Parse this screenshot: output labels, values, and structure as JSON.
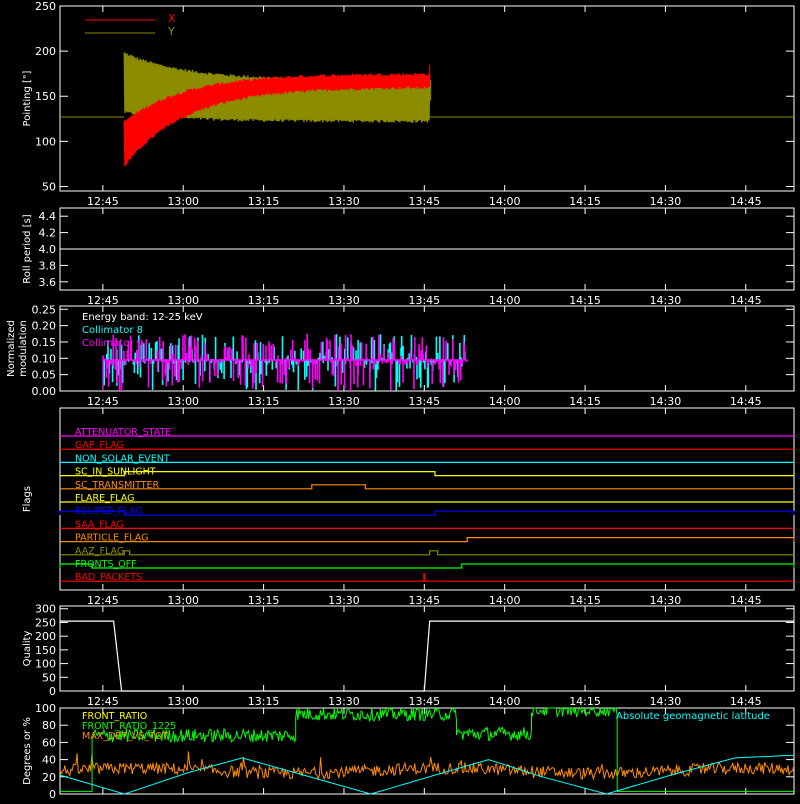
{
  "colors": {
    "background": "#000000",
    "frame": "#ffffff",
    "x_red": "#ff0000",
    "y_olive": "#8c8c00",
    "cyan": "#00ffff",
    "magenta": "#ff00ff",
    "green": "#00ff00",
    "orange": "#ff8c00",
    "yellow": "#ffff00",
    "blue": "#0000ff"
  },
  "x_axis": {
    "range_minutes": [
      -68,
      69
    ],
    "tick_minutes": [
      -60,
      -45,
      -30,
      -15,
      0,
      15,
      30,
      45,
      60
    ],
    "tick_labels": [
      "12:45",
      "13:00",
      "13:15",
      "13:30",
      "13:45",
      "14:00",
      "14:15",
      "14:30",
      "14:45"
    ]
  },
  "chart_data": [
    {
      "type": "line",
      "panel": "pointing",
      "ylabel": "Pointing [\"]",
      "ylim": [
        45,
        250
      ],
      "yticks": [
        50,
        100,
        150,
        200,
        250
      ],
      "legend_placement": "top-left",
      "series": [
        {
          "name": "X",
          "color": "#ff0000",
          "baseline": 127,
          "active_minutes": [
            -56,
            1
          ],
          "envelope_start": [
            72,
            122
          ],
          "envelope_end": [
            160,
            175
          ],
          "end_value": 185
        },
        {
          "name": "Y",
          "color": "#8c8c00",
          "baseline": 127,
          "active_minutes": [
            -56,
            1
          ],
          "envelope_start": [
            132,
            198
          ],
          "envelope_end": [
            122,
            168
          ],
          "end_value": 145
        }
      ]
    },
    {
      "type": "line",
      "panel": "roll",
      "ylabel": "Roll period [s]",
      "ylim": [
        3.5,
        4.5
      ],
      "yticks": [
        3.6,
        3.8,
        4.0,
        4.2,
        4.4
      ],
      "series": [
        {
          "color": "#ffffff",
          "value": 4.0
        }
      ]
    },
    {
      "type": "bar",
      "panel": "modulation",
      "ylabel": "Normalized modulation",
      "ylim": [
        0,
        0.26
      ],
      "yticks": [
        0.0,
        0.05,
        0.1,
        0.15,
        0.2,
        0.25
      ],
      "annotation": "Energy band: 12-25 keV",
      "baseline": 0.095,
      "active_minutes": [
        -60,
        8
      ],
      "series": [
        {
          "name": "Collimator 8",
          "color": "#00ffff"
        },
        {
          "name": "Collimator 9",
          "color": "#ff00ff"
        }
      ]
    },
    {
      "type": "line",
      "panel": "flags",
      "ylabel": "Flags",
      "flags": [
        {
          "name": "ATTENUATOR_STATE",
          "color": "#ff00ff",
          "high": []
        },
        {
          "name": "GAP_FLAG",
          "color": "#ff0000",
          "high": []
        },
        {
          "name": "NON_SOLAR_EVENT",
          "color": "#00ffff",
          "high": []
        },
        {
          "name": "SC_IN_SUNLIGHT",
          "color": "#ffff00",
          "high": [
            [
              -56,
              2
            ]
          ]
        },
        {
          "name": "SC_TRANSMITTER",
          "color": "#ff8c00",
          "high": [
            [
              -21,
              -11
            ]
          ]
        },
        {
          "name": "FLARE_FLAG",
          "color": "#ffff00",
          "high": []
        },
        {
          "name": "ECLIPSE_FLAG",
          "color": "#0000ff",
          "high": [
            [
              -68,
              -56
            ],
            [
              2,
              69
            ]
          ]
        },
        {
          "name": "SAA_FLAG",
          "color": "#ff0000",
          "high": []
        },
        {
          "name": "PARTICLE_FLAG",
          "color": "#ff8c00",
          "high": [
            [
              8,
              69
            ]
          ]
        },
        {
          "name": "AAZ_FLAG",
          "color": "#8c8c00",
          "high": [
            [
              -56,
              -55
            ],
            [
              1,
              2.5
            ]
          ]
        },
        {
          "name": "FRONTS_OFF",
          "color": "#00ff00",
          "high": [
            [
              -68,
              -62
            ],
            [
              7,
              69
            ]
          ]
        },
        {
          "name": "BAD_PACKETS",
          "color": "#ff0000",
          "high": []
        }
      ],
      "spikes": [
        {
          "flag": "BAD_PACKETS",
          "minute": 0
        }
      ]
    },
    {
      "type": "line",
      "panel": "quality",
      "ylabel": "Quality",
      "ylim": [
        0,
        310
      ],
      "yticks": [
        0,
        50,
        100,
        150,
        200,
        250,
        300
      ],
      "series": [
        {
          "color": "#ffffff",
          "points": [
            [
              -68,
              255
            ],
            [
              -58,
              255
            ],
            [
              -56.5,
              0
            ],
            [
              0,
              0
            ],
            [
              1,
              255
            ],
            [
              69,
              255
            ]
          ]
        }
      ]
    },
    {
      "type": "line",
      "panel": "ratios",
      "ylabel": "Degrees or %",
      "ylim": [
        0,
        100
      ],
      "yticks": [
        0,
        20,
        40,
        60,
        80,
        100
      ],
      "legend_placement": "top-left",
      "series": [
        {
          "name": "FRONT_RATIO",
          "color": "#ffff00"
        },
        {
          "name": "FRONT_RATIO_1225",
          "color": "#00ff00",
          "levels": [
            [
              -68,
              -62,
              3
            ],
            [
              -62,
              -24,
              68
            ],
            [
              -24,
              6,
              93
            ],
            [
              6,
              20,
              70
            ],
            [
              20,
              36,
              98
            ],
            [
              36,
              69,
              3
            ]
          ]
        },
        {
          "name": "MAX_DET_VS_TOT",
          "color": "#ff8c00",
          "level": 27
        },
        {
          "name": "Absolute geomagnetic latitude",
          "color": "#00ffff",
          "points": [
            [
              -68,
              22
            ],
            [
              -56,
              0
            ],
            [
              -44,
              25
            ],
            [
              -34,
              42
            ],
            [
              -22,
              21
            ],
            [
              -10,
              0
            ],
            [
              2,
              22
            ],
            [
              12,
              40
            ],
            [
              22,
              20
            ],
            [
              34,
              0
            ],
            [
              46,
              22
            ],
            [
              58,
              42
            ],
            [
              69,
              45
            ]
          ]
        }
      ]
    }
  ]
}
